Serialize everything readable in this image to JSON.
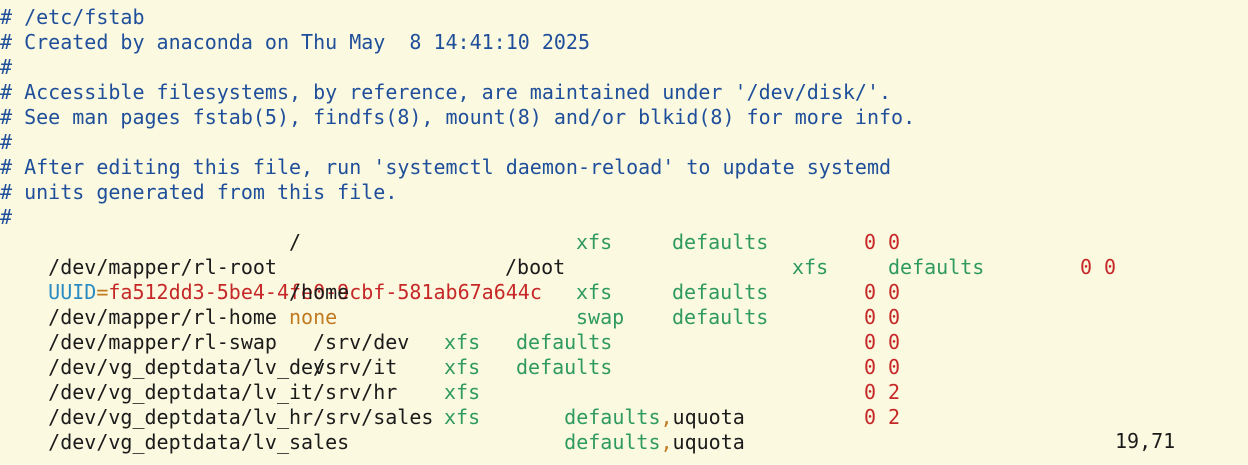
{
  "editor": {
    "comments": [
      "# /etc/fstab",
      "# Created by anaconda on Thu May  8 14:41:10 2025",
      "#",
      "# Accessible filesystems, by reference, are maintained under '/dev/disk/'.",
      "# See man pages fstab(5), findfs(8), mount(8) and/or blkid(8) for more info.",
      "#",
      "# After editing this file, run 'systemctl daemon-reload' to update systemd",
      "# units generated from this file.",
      "#"
    ],
    "entries": [
      {
        "device": "/dev/mapper/rl-root",
        "mount": "/",
        "fstype": "xfs",
        "options": "defaults",
        "dump": "0",
        "pass": "0"
      },
      {
        "uuid_key": "UUID",
        "eq": "=",
        "uuid_value": "fa512dd3-5be4-4fe0-9cbf-581ab67a644c",
        "mount": "/boot",
        "fstype": "xfs",
        "options": "defaults",
        "dump": "0",
        "pass": "0"
      },
      {
        "device": "/dev/mapper/rl-home",
        "mount": "/home",
        "fstype": "xfs",
        "options": "defaults",
        "dump": "0",
        "pass": "0"
      },
      {
        "device": "/dev/mapper/rl-swap",
        "mount": "none",
        "fstype": "swap",
        "options": "defaults",
        "dump": "0",
        "pass": "0"
      },
      {
        "device": "/dev/vg_deptdata/lv_dev",
        "mount": "/srv/dev",
        "fstype": "xfs",
        "options": "defaults",
        "dump": "0",
        "pass": "0"
      },
      {
        "device": "/dev/vg_deptdata/lv_it",
        "mount": "/srv/it",
        "fstype": "xfs",
        "options": "defaults",
        "dump": "0",
        "pass": "0"
      },
      {
        "device": "/dev/vg_deptdata/lv_hr",
        "mount": "/srv/hr",
        "fstype": "xfs",
        "options": "defaults",
        "comma": ",",
        "extra": "uquota",
        "dump": "0",
        "pass": "2"
      },
      {
        "device": "/dev/vg_deptdata/lv_sales",
        "mount": "/srv/sales",
        "fstype": "xfs",
        "options": "defaults",
        "comma": ",",
        "extra": "uquota",
        "dump": "0",
        "pass": "2"
      }
    ]
  },
  "statusline": {
    "cursor_position": "19,71"
  },
  "colors": {
    "background": "#fbf9e0",
    "comment": "#1f4f9a",
    "fstype": "#2e9a5e",
    "number": "#c62828",
    "uuid_key": "#2b8cc4",
    "accent_orange": "#c07a20"
  }
}
